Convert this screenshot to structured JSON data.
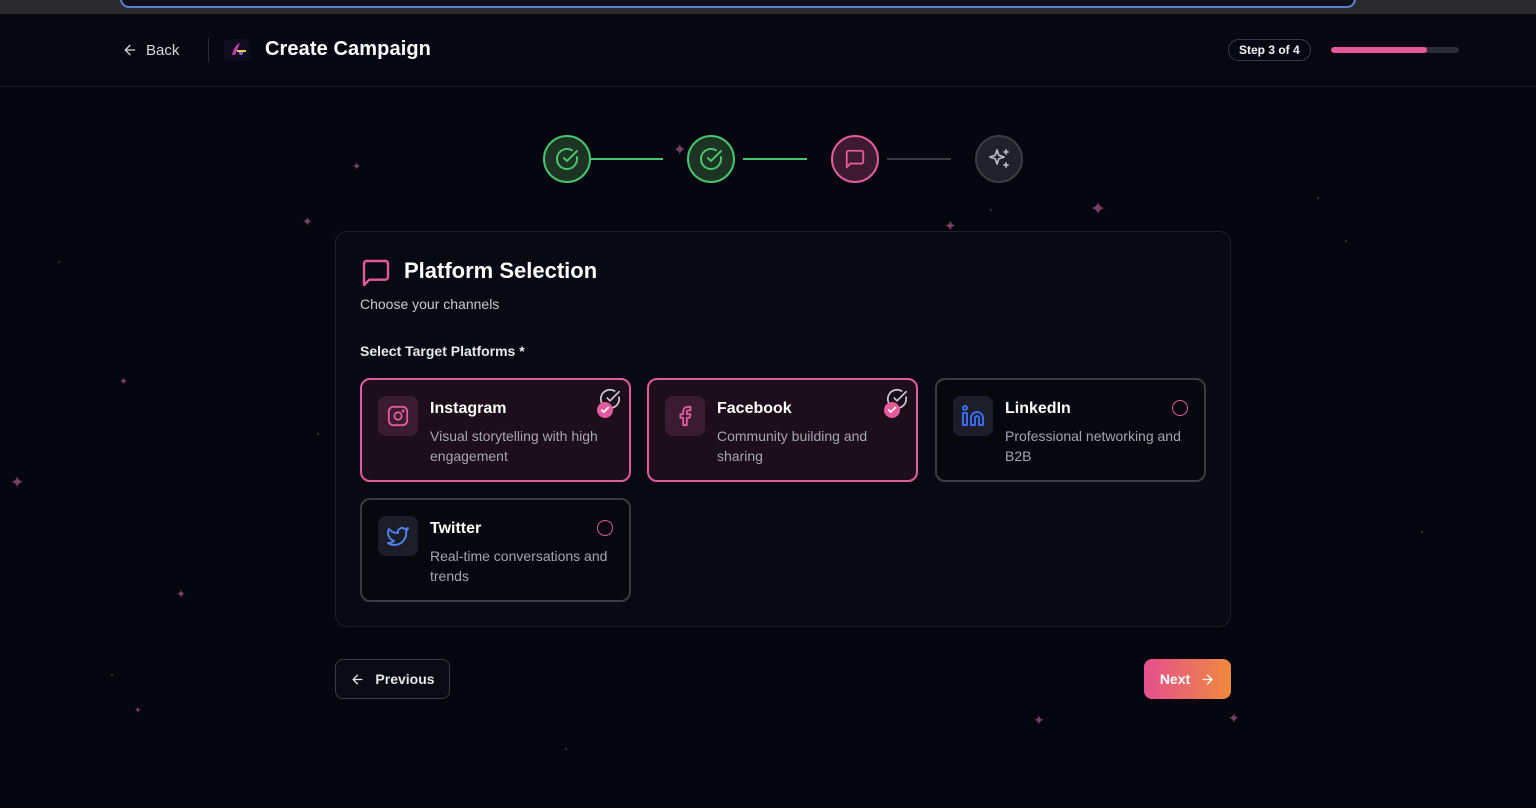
{
  "header": {
    "back_label": "Back",
    "title": "Create Campaign",
    "step_badge": "Step 3 of 4",
    "progress_fraction": 0.75
  },
  "stepper": {
    "steps": [
      {
        "status": "completed",
        "icon": "check-circle-icon"
      },
      {
        "status": "completed",
        "icon": "check-circle-icon"
      },
      {
        "status": "active",
        "icon": "message-square-icon"
      },
      {
        "status": "upcoming",
        "icon": "sparkles-icon"
      }
    ]
  },
  "card": {
    "title": "Platform Selection",
    "subtitle": "Choose your channels",
    "field_label": "Select Target Platforms *",
    "platforms": [
      {
        "name": "Instagram",
        "description": "Visual storytelling with high engagement",
        "selected": true,
        "icon": "instagram-icon"
      },
      {
        "name": "Facebook",
        "description": "Community building and sharing",
        "selected": true,
        "icon": "facebook-icon"
      },
      {
        "name": "LinkedIn",
        "description": "Professional networking and B2B",
        "selected": false,
        "icon": "linkedin-icon"
      },
      {
        "name": "Twitter",
        "description": "Real-time conversations and trends",
        "selected": false,
        "icon": "twitter-icon"
      }
    ]
  },
  "footer": {
    "previous_label": "Previous",
    "next_label": "Next"
  },
  "colors": {
    "accent": "#e45a9b",
    "success": "#46c46c",
    "background": "#060611",
    "gradient_start": "#e4508f",
    "gradient_end": "#ef8a3c"
  }
}
